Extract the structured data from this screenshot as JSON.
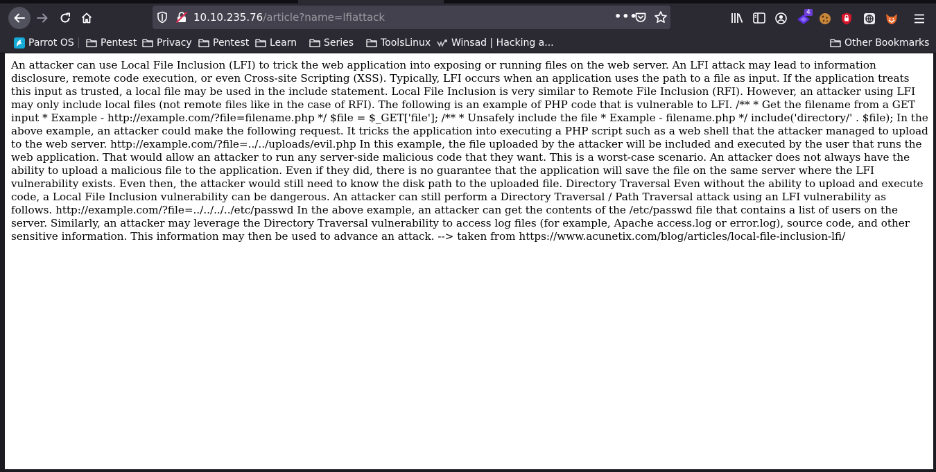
{
  "browser": {
    "url_host": "10.10.235.76",
    "url_path": "/article?name=lfiattack",
    "badge_count": "4",
    "icons": [
      "back-arrow-icon",
      "forward-arrow-icon",
      "reload-icon",
      "home-icon",
      "tracking-shield-icon",
      "insecure-lock-icon",
      "page-actions-menu-icon",
      "pocket-icon",
      "bookmark-star-icon",
      "library-icon",
      "sidebar-icon",
      "account-icon",
      "extension-icon",
      "cookie-icon",
      "ublock-icon",
      "proxy-icon",
      "foxyproxy-icon",
      "hamburger-menu-icon"
    ]
  },
  "bookmarks": {
    "items": [
      "Parrot OS",
      "Pentest",
      "Privacy",
      "Pentest",
      "Learn",
      "Series",
      "ToolsLinux",
      "Winsad | Hacking a..."
    ],
    "other": "Other Bookmarks"
  },
  "article": {
    "text": "An attacker can use Local File Inclusion (LFI) to trick the web application into exposing or running files on the web server. An LFI attack may lead to information disclosure, remote code execution, or even Cross-site Scripting (XSS). Typically, LFI occurs when an application uses the path to a file as input. If the application treats this input as trusted, a local file may be used in the include statement. Local File Inclusion is very similar to Remote File Inclusion (RFI). However, an attacker using LFI may only include local files (not remote files like in the case of RFI). The following is an example of PHP code that is vulnerable to LFI. /** * Get the filename from a GET input * Example - http://example.com/?file=filename.php */ $file = $_GET['file']; /** * Unsafely include the file * Example - filename.php */ include('directory/' . $file); In the above example, an attacker could make the following request. It tricks the application into executing a PHP script such as a web shell that the attacker managed to upload to the web server. http://example.com/?file=../../uploads/evil.php In this example, the file uploaded by the attacker will be included and executed by the user that runs the web application. That would allow an attacker to run any server-side malicious code that they want. This is a worst-case scenario. An attacker does not always have the ability to upload a malicious file to the application. Even if they did, there is no guarantee that the application will save the file on the same server where the LFI vulnerability exists. Even then, the attacker would still need to know the disk path to the uploaded file. Directory Traversal Even without the ability to upload and execute code, a Local File Inclusion vulnerability can be dangerous. An attacker can still perform a Directory Traversal / Path Traversal attack using an LFI vulnerability as follows. http://example.com/?file=../../../../etc/passwd In the above example, an attacker can get the contents of the /etc/passwd file that contains a list of users on the server. Similarly, an attacker may leverage the Directory Traversal vulnerability to access log files (for example, Apache access.log or error.log), source code, and other sensitive information. This information may then be used to advance an attack. --> taken from https://www.acunetix.com/blog/articles/local-file-inclusion-lfi/"
  },
  "colors": {
    "chrome": "#2b2a33",
    "urlbar": "#42414d",
    "frame": "#1c1b22",
    "text_light": "#fbfbfe",
    "path_text": "#9a9aa2",
    "page_bg": "#ffffff"
  }
}
